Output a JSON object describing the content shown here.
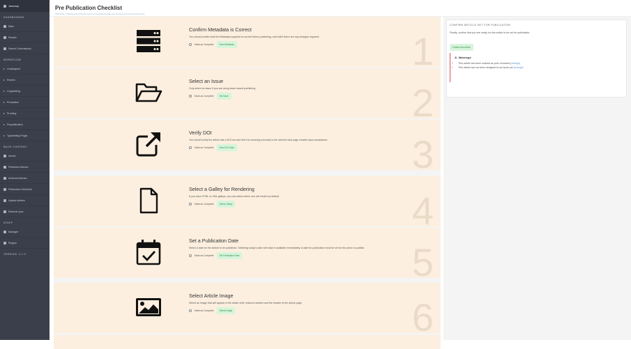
{
  "sidebar": {
    "user": "Janeway",
    "sections": [
      {
        "label": "DASHBOARDS"
      },
      {
        "label": "WORKFLOW"
      },
      {
        "label": "BACK CONTENT"
      },
      {
        "label": "STAFF"
      },
      {
        "label": "VERSION: 1.7.3"
      }
    ],
    "dashboards": [
      "Main",
      "Reader",
      "Search Submissions"
    ],
    "workflow": [
      "Unassigned",
      "Review",
      "Copyediting",
      "Production",
      "Proofing",
      "Prepublication",
      "Typesetting Plugin"
    ],
    "back_content": [
      "Issues",
      "Published Articles",
      "Archived Articles",
      "Publication Schedule",
      "Upload articles",
      "External sync"
    ],
    "staff": [
      "Manager",
      "Plugins"
    ]
  },
  "header": {
    "title": "Pre Publication Checklist",
    "breadcrumb": "Wild Guide / Kaleidoscopic Ratio Perception in Repeated Equations to Extreme Seminars Environments"
  },
  "steps": [
    {
      "title": "Confirm Metadata is Correct",
      "desc": "You should confirm that the Metadata supplied is correct before publishing, and edit if there are any changes required.",
      "mark": "Mark as Complete",
      "btn": "View Metadata",
      "num": "1",
      "icon": "server-icon"
    },
    {
      "title": "Select an Issue",
      "desc": "Only select an issue if you are doing issue based publishing.",
      "mark": "Mark as Complete",
      "btn": "Set Issue",
      "num": "2",
      "icon": "folder-open-icon"
    },
    {
      "title": "Verify DOI",
      "desc": "You should verify the article has a DOI set and that it is resolving correctly to the article's stub page created upon acceptance.",
      "mark": "Mark as Complete",
      "btn": "View DOI Data",
      "num": "3",
      "icon": "external-link-icon"
    },
    {
      "title": "Select a Galley for Rendering",
      "desc": "If you have HTML or XML galleys, you can select which one will render by default.",
      "mark": "Mark as Complete",
      "btn": "Select Galley",
      "num": "4",
      "icon": "file-icon"
    },
    {
      "title": "Set a Publication Date",
      "desc": "Select a date for the Article to be published. Selecting today's date will make it available immediately. A date for publication must be set for the piece to publish.",
      "mark": "Mark as Complete",
      "btn": "Set Publication Date",
      "num": "5",
      "icon": "calendar-check-icon"
    },
    {
      "title": "Select Article Image",
      "desc": "Select an image that will appear in the article orbit, featured articles and the header of the article page.",
      "mark": "Mark as Complete",
      "btn": "Select Image",
      "num": "6",
      "icon": "image-icon"
    }
  ],
  "panel": {
    "title": "CONFIRM ARTICLE SET FOR PUBLICATION",
    "desc": "Finally, confirm that you are ready for this article to be set for publication.",
    "publish_btn": "Publish this Article",
    "warnings_title": "Warnings",
    "warnings": [
      {
        "text": "This article has been marked as peer reviewed",
        "link": "[change]"
      },
      {
        "text": "This article has not been assigned to an issue yet",
        "link": "[change]"
      }
    ]
  }
}
